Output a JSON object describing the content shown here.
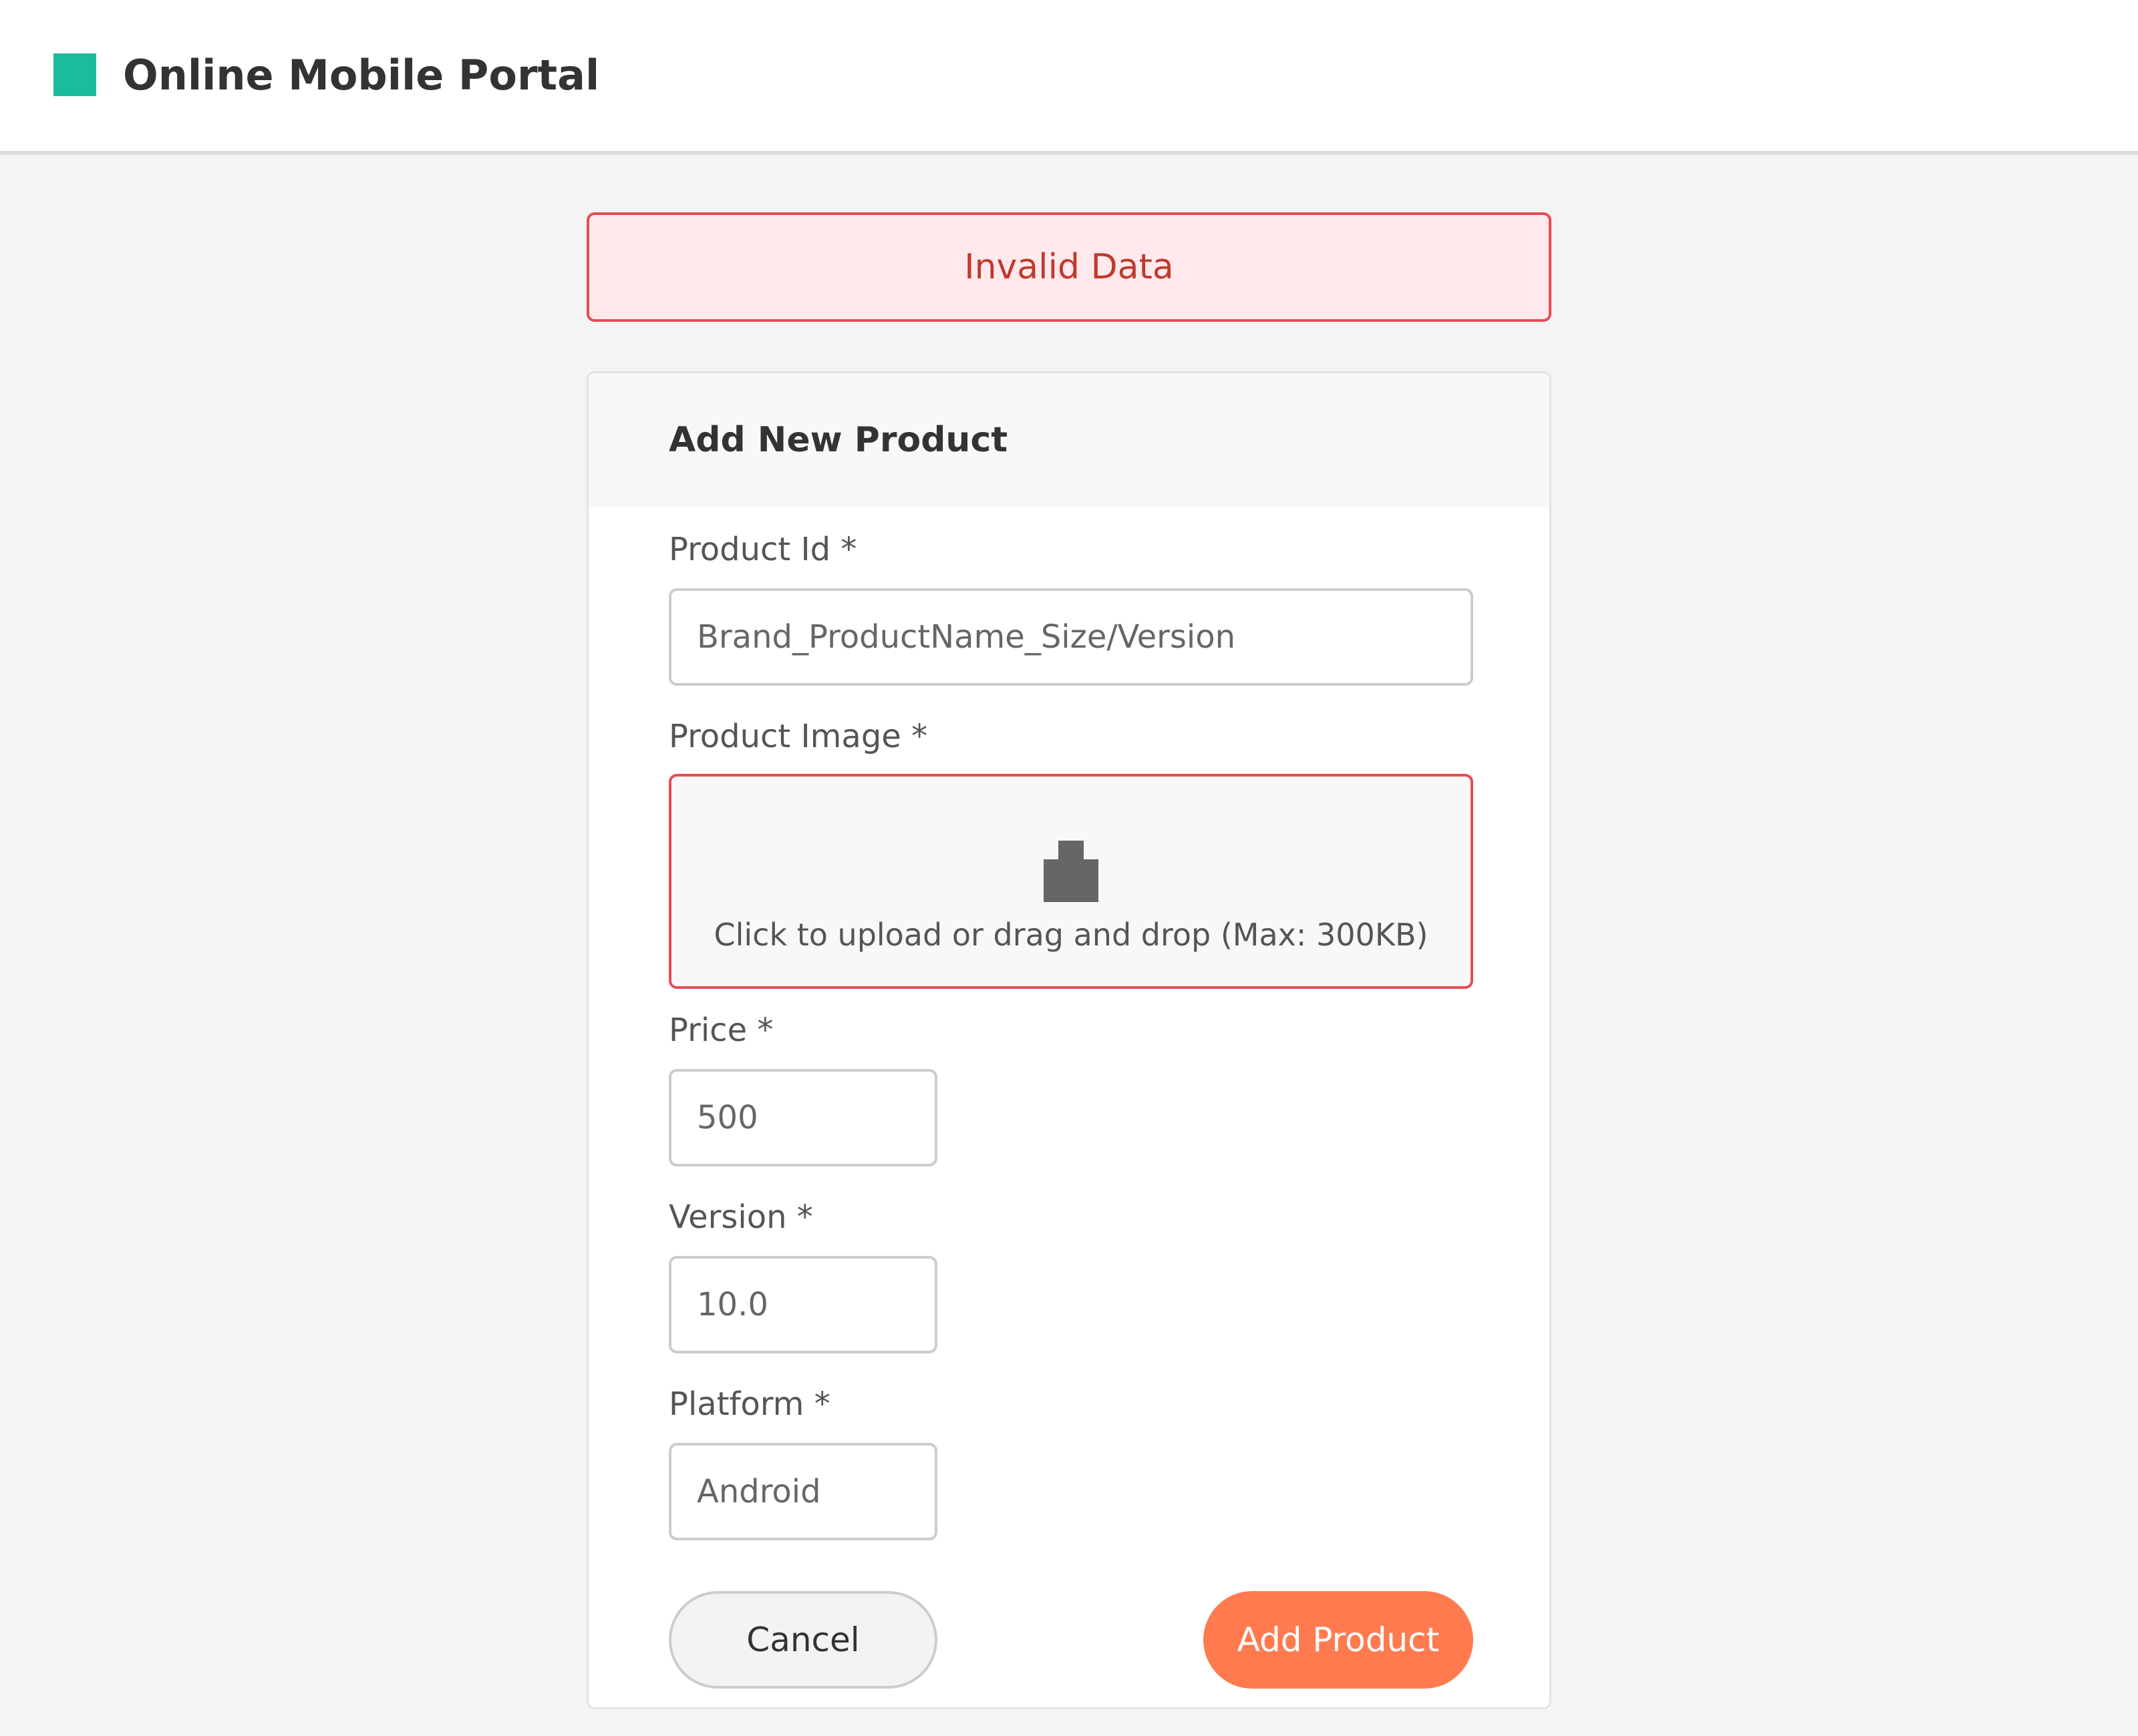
{
  "header": {
    "app_title": "Online Mobile Portal",
    "logo_color": "#1abc9c"
  },
  "alert": {
    "message": "Invalid Data",
    "type": "error",
    "color": "#c0392b"
  },
  "form": {
    "title": "Add New Product",
    "product_id": {
      "label": "Product Id *",
      "value": "",
      "placeholder": "Brand_ProductName_Size/Version"
    },
    "product_image": {
      "label": "Product Image *",
      "icon": "upload-icon",
      "upload_text": "Click to upload or drag and drop (Max: 300KB)",
      "state": "error"
    },
    "price": {
      "label": "Price *",
      "value": "",
      "placeholder": "500"
    },
    "version": {
      "label": "Version *",
      "value": "",
      "placeholder": "10.0"
    },
    "platform": {
      "label": "Platform *",
      "value": "",
      "placeholder": "Android"
    },
    "buttons": {
      "cancel_label": "Cancel",
      "submit_label": "Add Product",
      "submit_color": "#ff7b4f"
    }
  }
}
